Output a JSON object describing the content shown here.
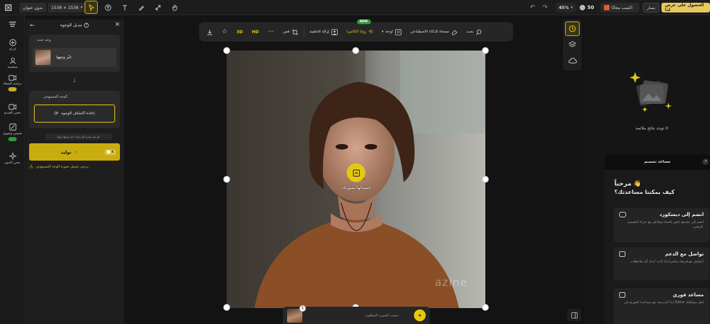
{
  "colors": {
    "accent": "#e5c812",
    "brand_yellow": "#c9b01c",
    "bg": "#141414",
    "panel": "#1e1e1e"
  },
  "topbar": {
    "upgrade_label": "الحصول على عرض لذا",
    "user_label": "يسار",
    "gift_label": "اكسب مجانًا",
    "credits": "50",
    "zoom": "45%",
    "dimensions": "1536 × 1536",
    "doc_title": "بدون عنوان"
  },
  "rail": {
    "items": [
      {
        "label": ""
      },
      {
        "label": "إدراج"
      },
      {
        "label": "شخصية"
      },
      {
        "label": "مزامنة الشفاه",
        "badge": ""
      },
      {
        "label": "محرر الفيديو"
      },
      {
        "label": "تحسين وتحويل",
        "badge": ""
      },
      {
        "label": "محرر الصور"
      }
    ]
  },
  "panel": {
    "title": "تبديل الوجوه",
    "source_section": "وجه جديد",
    "source_item": "غيّر وجهها",
    "target_section": "الوجه المستهدف",
    "redetect_button": "إعادة اكتشاف الوجوه",
    "hint": "لم يتم تحديد أي وجه؟ حدد وجهًا يدويًا",
    "generate_button": "توليد",
    "generate_cost": "4",
    "warning": "يرجى تحميل صورة الوجه المستهدف."
  },
  "floatbar": {
    "items": [
      {
        "label": ""
      },
      {
        "label": ""
      },
      {
        "label": ""
      },
      {
        "label": ""
      },
      {
        "label": ""
      },
      {
        "label": "قص"
      },
      {
        "label": "إزالة الخلفية"
      },
      {
        "label": "زوايا الكاميرا",
        "badge": "NEW"
      },
      {
        "label": "لوحة"
      },
      {
        "label": "ممحاة الذكاء الاصطناعي"
      },
      {
        "label": "بحث"
      }
    ]
  },
  "canvas": {
    "overlay_text": "استبدلها بصورتك",
    "watermark": "azine",
    "strip_label": "سحب الصورة المطلوبة",
    "strip_badge": "1"
  },
  "rpanel": {
    "empty_text": "لا توجد نتائج ملائمة",
    "assistant_tab": "مساعد تصميم",
    "greeting": "مرحباً 👋",
    "question": "كيف يمكننا مساعدتك؟",
    "cards": [
      {
        "title": "انضم إلى ديسكورد",
        "desc": "انضم إلى مجتمع نابض بالحياة وتفاعل مع خبراء التصميم الرقمي."
      },
      {
        "title": "تواصل مع الدعم",
        "desc": "تواصل مع فريقنا مباشرةً إذا كانت لديك أي ملاحظات!"
      },
      {
        "title": "مساعد فوري",
        "desc": "ابدأ الدردشة مع مساعدنا الفوري في Dzine لحل مشكلتك"
      }
    ]
  }
}
